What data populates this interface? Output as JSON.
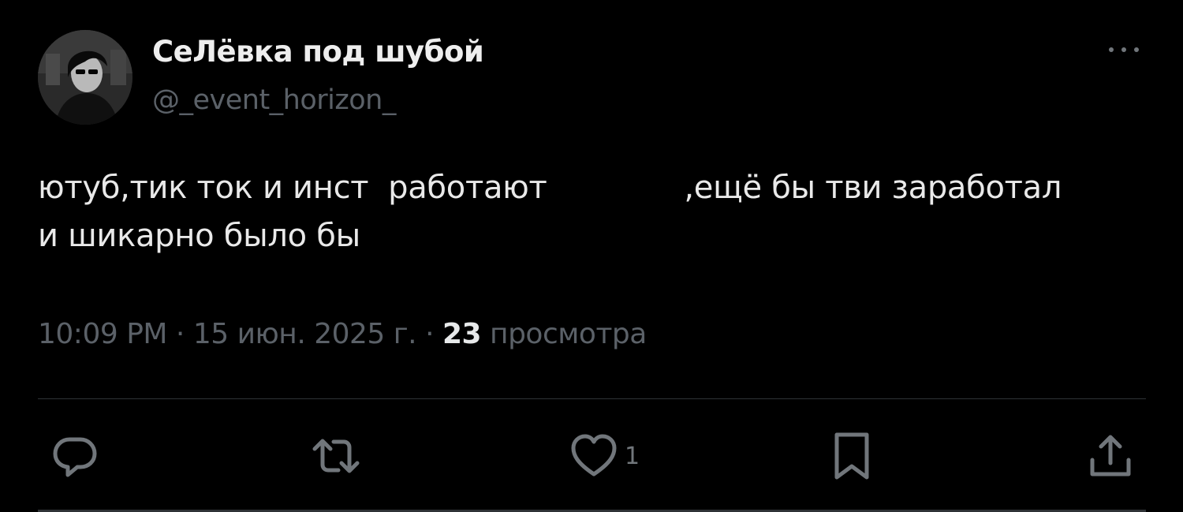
{
  "author": {
    "display_name": "СеЛёвка под шубой",
    "handle": "@_event_horizon_"
  },
  "tweet": {
    "text": "ютуб,тик ток и инст  работают              ,ещё бы тви заработал\nи шикарно было бы",
    "time": "10:09 PM",
    "date": "15 июн. 2025 г.",
    "separator": "·",
    "views_count": "23",
    "views_label": "просмотра"
  },
  "actions": {
    "reply_icon": "reply-icon",
    "retweet_icon": "retweet-icon",
    "like_icon": "like-icon",
    "like_count": "1",
    "bookmark_icon": "bookmark-icon",
    "share_icon": "share-icon",
    "more_icon": "more-icon"
  },
  "colors": {
    "background": "#000000",
    "text": "#e7e9ea",
    "secondary": "#5b6168",
    "icon": "#71767b",
    "divider": "#2f3336"
  }
}
